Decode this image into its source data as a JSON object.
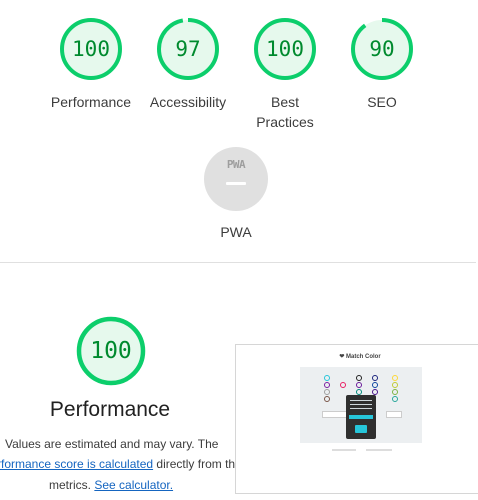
{
  "categories": [
    {
      "label": "Performance",
      "score": "100",
      "value": 100
    },
    {
      "label": "Accessibility",
      "score": "97",
      "value": 97
    },
    {
      "label": "Best Practices",
      "label_line1": "Best",
      "label_line2": "Practices",
      "score": "100",
      "value": 100
    },
    {
      "label": "SEO",
      "score": "90",
      "value": 90
    }
  ],
  "pwa": {
    "badge_text": "PWA",
    "label": "PWA"
  },
  "performance_section": {
    "score": "100",
    "value": 100,
    "title": "Performance",
    "note_line1": "Values are estimated and may vary. The",
    "note_link1": "rformance score is calculated",
    "note_line2_rest": " directly from thes",
    "note_line3_pre": "metrics. ",
    "note_link2": "See calculator."
  },
  "screenshot": {
    "title": "Match Color",
    "icon": "heart-icon"
  },
  "colors": {
    "pass": "#0cce6b",
    "pass_fill": "#e6f9ed",
    "pass_text": "#008a2e",
    "pwa_gray": "#e0e0e0",
    "link": "#1565c0"
  }
}
